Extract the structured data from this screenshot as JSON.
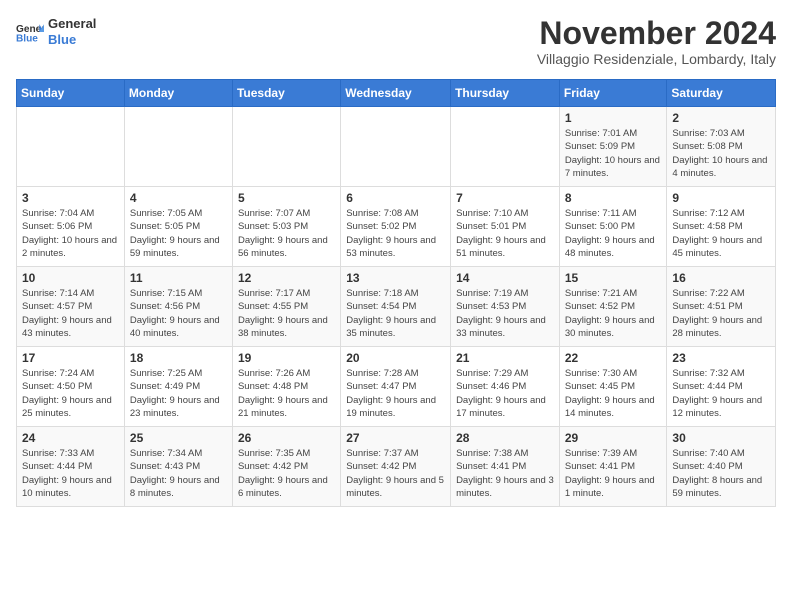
{
  "logo": {
    "general": "General",
    "blue": "Blue"
  },
  "title": "November 2024",
  "location": "Villaggio Residenziale, Lombardy, Italy",
  "days_of_week": [
    "Sunday",
    "Monday",
    "Tuesday",
    "Wednesday",
    "Thursday",
    "Friday",
    "Saturday"
  ],
  "weeks": [
    [
      {
        "day": "",
        "info": ""
      },
      {
        "day": "",
        "info": ""
      },
      {
        "day": "",
        "info": ""
      },
      {
        "day": "",
        "info": ""
      },
      {
        "day": "",
        "info": ""
      },
      {
        "day": "1",
        "info": "Sunrise: 7:01 AM\nSunset: 5:09 PM\nDaylight: 10 hours and 7 minutes."
      },
      {
        "day": "2",
        "info": "Sunrise: 7:03 AM\nSunset: 5:08 PM\nDaylight: 10 hours and 4 minutes."
      }
    ],
    [
      {
        "day": "3",
        "info": "Sunrise: 7:04 AM\nSunset: 5:06 PM\nDaylight: 10 hours and 2 minutes."
      },
      {
        "day": "4",
        "info": "Sunrise: 7:05 AM\nSunset: 5:05 PM\nDaylight: 9 hours and 59 minutes."
      },
      {
        "day": "5",
        "info": "Sunrise: 7:07 AM\nSunset: 5:03 PM\nDaylight: 9 hours and 56 minutes."
      },
      {
        "day": "6",
        "info": "Sunrise: 7:08 AM\nSunset: 5:02 PM\nDaylight: 9 hours and 53 minutes."
      },
      {
        "day": "7",
        "info": "Sunrise: 7:10 AM\nSunset: 5:01 PM\nDaylight: 9 hours and 51 minutes."
      },
      {
        "day": "8",
        "info": "Sunrise: 7:11 AM\nSunset: 5:00 PM\nDaylight: 9 hours and 48 minutes."
      },
      {
        "day": "9",
        "info": "Sunrise: 7:12 AM\nSunset: 4:58 PM\nDaylight: 9 hours and 45 minutes."
      }
    ],
    [
      {
        "day": "10",
        "info": "Sunrise: 7:14 AM\nSunset: 4:57 PM\nDaylight: 9 hours and 43 minutes."
      },
      {
        "day": "11",
        "info": "Sunrise: 7:15 AM\nSunset: 4:56 PM\nDaylight: 9 hours and 40 minutes."
      },
      {
        "day": "12",
        "info": "Sunrise: 7:17 AM\nSunset: 4:55 PM\nDaylight: 9 hours and 38 minutes."
      },
      {
        "day": "13",
        "info": "Sunrise: 7:18 AM\nSunset: 4:54 PM\nDaylight: 9 hours and 35 minutes."
      },
      {
        "day": "14",
        "info": "Sunrise: 7:19 AM\nSunset: 4:53 PM\nDaylight: 9 hours and 33 minutes."
      },
      {
        "day": "15",
        "info": "Sunrise: 7:21 AM\nSunset: 4:52 PM\nDaylight: 9 hours and 30 minutes."
      },
      {
        "day": "16",
        "info": "Sunrise: 7:22 AM\nSunset: 4:51 PM\nDaylight: 9 hours and 28 minutes."
      }
    ],
    [
      {
        "day": "17",
        "info": "Sunrise: 7:24 AM\nSunset: 4:50 PM\nDaylight: 9 hours and 25 minutes."
      },
      {
        "day": "18",
        "info": "Sunrise: 7:25 AM\nSunset: 4:49 PM\nDaylight: 9 hours and 23 minutes."
      },
      {
        "day": "19",
        "info": "Sunrise: 7:26 AM\nSunset: 4:48 PM\nDaylight: 9 hours and 21 minutes."
      },
      {
        "day": "20",
        "info": "Sunrise: 7:28 AM\nSunset: 4:47 PM\nDaylight: 9 hours and 19 minutes."
      },
      {
        "day": "21",
        "info": "Sunrise: 7:29 AM\nSunset: 4:46 PM\nDaylight: 9 hours and 17 minutes."
      },
      {
        "day": "22",
        "info": "Sunrise: 7:30 AM\nSunset: 4:45 PM\nDaylight: 9 hours and 14 minutes."
      },
      {
        "day": "23",
        "info": "Sunrise: 7:32 AM\nSunset: 4:44 PM\nDaylight: 9 hours and 12 minutes."
      }
    ],
    [
      {
        "day": "24",
        "info": "Sunrise: 7:33 AM\nSunset: 4:44 PM\nDaylight: 9 hours and 10 minutes."
      },
      {
        "day": "25",
        "info": "Sunrise: 7:34 AM\nSunset: 4:43 PM\nDaylight: 9 hours and 8 minutes."
      },
      {
        "day": "26",
        "info": "Sunrise: 7:35 AM\nSunset: 4:42 PM\nDaylight: 9 hours and 6 minutes."
      },
      {
        "day": "27",
        "info": "Sunrise: 7:37 AM\nSunset: 4:42 PM\nDaylight: 9 hours and 5 minutes."
      },
      {
        "day": "28",
        "info": "Sunrise: 7:38 AM\nSunset: 4:41 PM\nDaylight: 9 hours and 3 minutes."
      },
      {
        "day": "29",
        "info": "Sunrise: 7:39 AM\nSunset: 4:41 PM\nDaylight: 9 hours and 1 minute."
      },
      {
        "day": "30",
        "info": "Sunrise: 7:40 AM\nSunset: 4:40 PM\nDaylight: 8 hours and 59 minutes."
      }
    ]
  ]
}
